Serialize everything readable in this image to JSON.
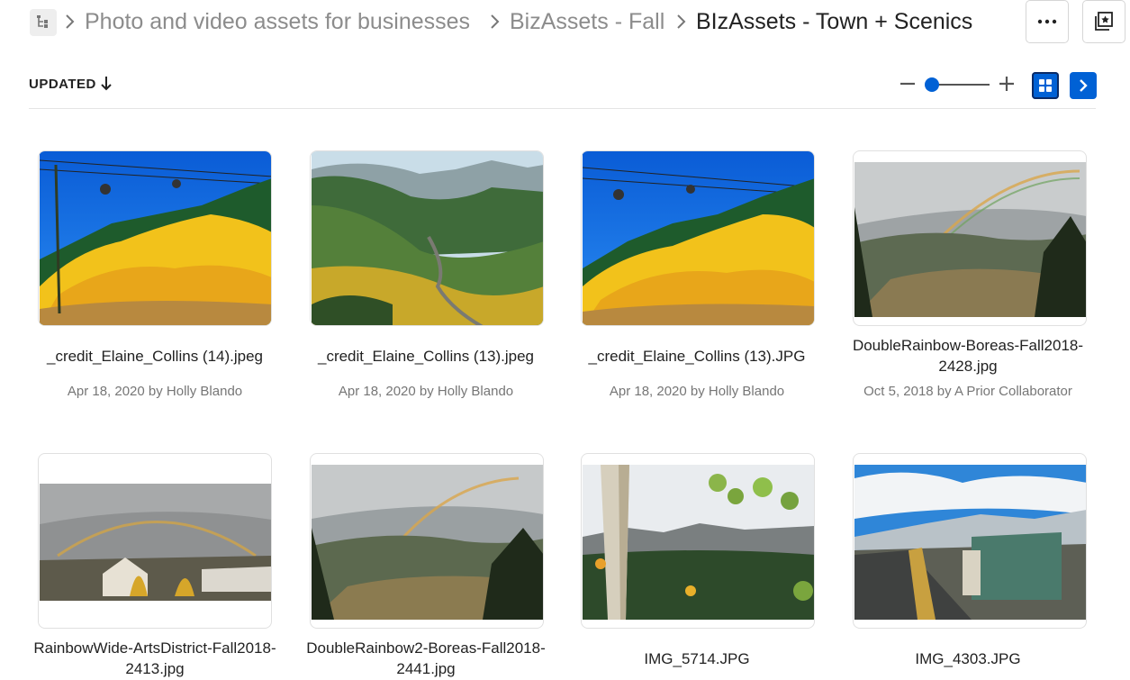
{
  "breadcrumb": {
    "items": [
      "Photo and video assets for businesses",
      "BizAssets - Fall",
      "BIzAssets - Town + Scenics"
    ]
  },
  "toolbar": {
    "sort_label": "UPDATED",
    "sort_direction": "descending"
  },
  "files": [
    {
      "name": "_credit_Elaine_Collins (14).jpeg",
      "meta": "Apr 18, 2020 by Holly Blando"
    },
    {
      "name": "_credit_Elaine_Collins (13).jpeg",
      "meta": "Apr 18, 2020 by Holly Blando"
    },
    {
      "name": "_credit_Elaine_Collins (13).JPG",
      "meta": "Apr 18, 2020 by Holly Blando"
    },
    {
      "name": "DoubleRainbow-Boreas-Fall2018-2428.jpg",
      "meta": "Oct 5, 2018 by A Prior Collaborator"
    },
    {
      "name": "RainbowWide-ArtsDistrict-Fall2018-2413.jpg",
      "meta": ""
    },
    {
      "name": "DoubleRainbow2-Boreas-Fall2018-2441.jpg",
      "meta": ""
    },
    {
      "name": "IMG_5714.JPG",
      "meta": ""
    },
    {
      "name": "IMG_4303.JPG",
      "meta": ""
    }
  ],
  "colors": {
    "accent": "#0061d5",
    "muted_text": "#8c8c8c"
  },
  "icons": {
    "tree": "folder-tree-icon",
    "more": "more-options-icon",
    "collections": "collections-icon",
    "grid": "grid-view-icon",
    "next": "chevron-right-icon"
  }
}
